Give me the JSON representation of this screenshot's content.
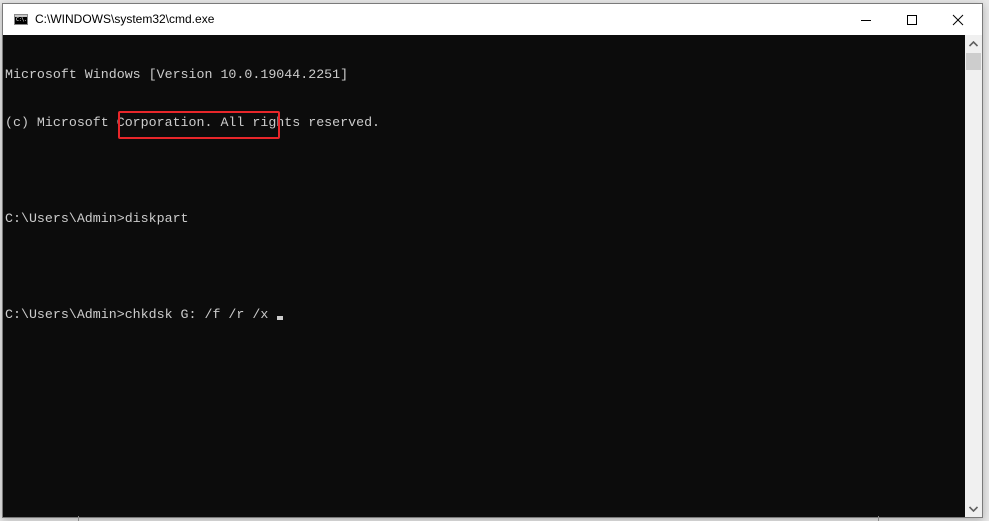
{
  "window": {
    "title": "C:\\WINDOWS\\system32\\cmd.exe",
    "app_icon_text": "C:\\."
  },
  "title_buttons": {
    "minimize": "minimize",
    "maximize": "maximize",
    "close": "close"
  },
  "console": {
    "lines": [
      "Microsoft Windows [Version 10.0.19044.2251]",
      "(c) Microsoft Corporation. All rights reserved.",
      "",
      "C:\\Users\\Admin>diskpart",
      "",
      "C:\\Users\\Admin>chkdsk G: /f /r /x "
    ],
    "highlighted_command": "chkdsk G: /f /r /x",
    "highlight_color": "#e8262a",
    "text_color": "#cccccc",
    "background_color": "#0c0c0c"
  }
}
